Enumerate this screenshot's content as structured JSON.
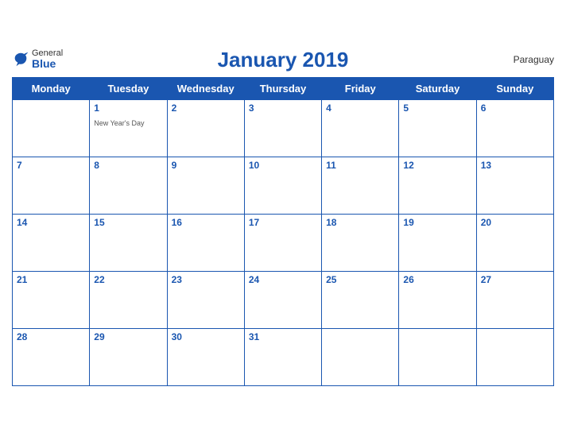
{
  "header": {
    "title": "January 2019",
    "country": "Paraguay",
    "logo_general": "General",
    "logo_blue": "Blue"
  },
  "weekdays": [
    "Monday",
    "Tuesday",
    "Wednesday",
    "Thursday",
    "Friday",
    "Saturday",
    "Sunday"
  ],
  "weeks": [
    [
      {
        "day": "",
        "empty": true
      },
      {
        "day": "1",
        "event": "New Year's Day"
      },
      {
        "day": "2",
        "event": ""
      },
      {
        "day": "3",
        "event": ""
      },
      {
        "day": "4",
        "event": ""
      },
      {
        "day": "5",
        "event": ""
      },
      {
        "day": "6",
        "event": ""
      }
    ],
    [
      {
        "day": "7",
        "event": ""
      },
      {
        "day": "8",
        "event": ""
      },
      {
        "day": "9",
        "event": ""
      },
      {
        "day": "10",
        "event": ""
      },
      {
        "day": "11",
        "event": ""
      },
      {
        "day": "12",
        "event": ""
      },
      {
        "day": "13",
        "event": ""
      }
    ],
    [
      {
        "day": "14",
        "event": ""
      },
      {
        "day": "15",
        "event": ""
      },
      {
        "day": "16",
        "event": ""
      },
      {
        "day": "17",
        "event": ""
      },
      {
        "day": "18",
        "event": ""
      },
      {
        "day": "19",
        "event": ""
      },
      {
        "day": "20",
        "event": ""
      }
    ],
    [
      {
        "day": "21",
        "event": ""
      },
      {
        "day": "22",
        "event": ""
      },
      {
        "day": "23",
        "event": ""
      },
      {
        "day": "24",
        "event": ""
      },
      {
        "day": "25",
        "event": ""
      },
      {
        "day": "26",
        "event": ""
      },
      {
        "day": "27",
        "event": ""
      }
    ],
    [
      {
        "day": "28",
        "event": ""
      },
      {
        "day": "29",
        "event": ""
      },
      {
        "day": "30",
        "event": ""
      },
      {
        "day": "31",
        "event": ""
      },
      {
        "day": "",
        "empty": true
      },
      {
        "day": "",
        "empty": true
      },
      {
        "day": "",
        "empty": true
      }
    ]
  ]
}
